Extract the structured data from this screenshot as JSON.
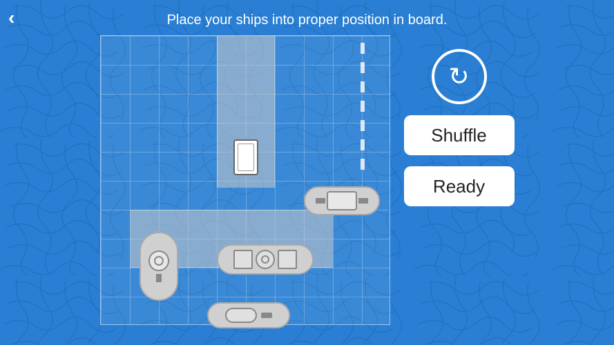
{
  "page": {
    "background_color": "#2a7fd4"
  },
  "header": {
    "title": "Place your ships into proper position in board.",
    "back_label": "‹"
  },
  "buttons": {
    "rotate_aria": "Rotate ship",
    "shuffle_label": "Shuffle",
    "ready_label": "Ready"
  },
  "board": {
    "grid_size": 10,
    "cell_size": 42
  },
  "ships": [
    {
      "id": "ship-single",
      "type": "1-cell-vertical"
    },
    {
      "id": "ship-2h",
      "type": "2-cell-horizontal-arrow"
    },
    {
      "id": "ship-vertical-circle",
      "type": "vertical-circle"
    },
    {
      "id": "ship-3h-center",
      "type": "3-cell-horizontal"
    },
    {
      "id": "ship-small-h",
      "type": "small-horizontal"
    }
  ]
}
